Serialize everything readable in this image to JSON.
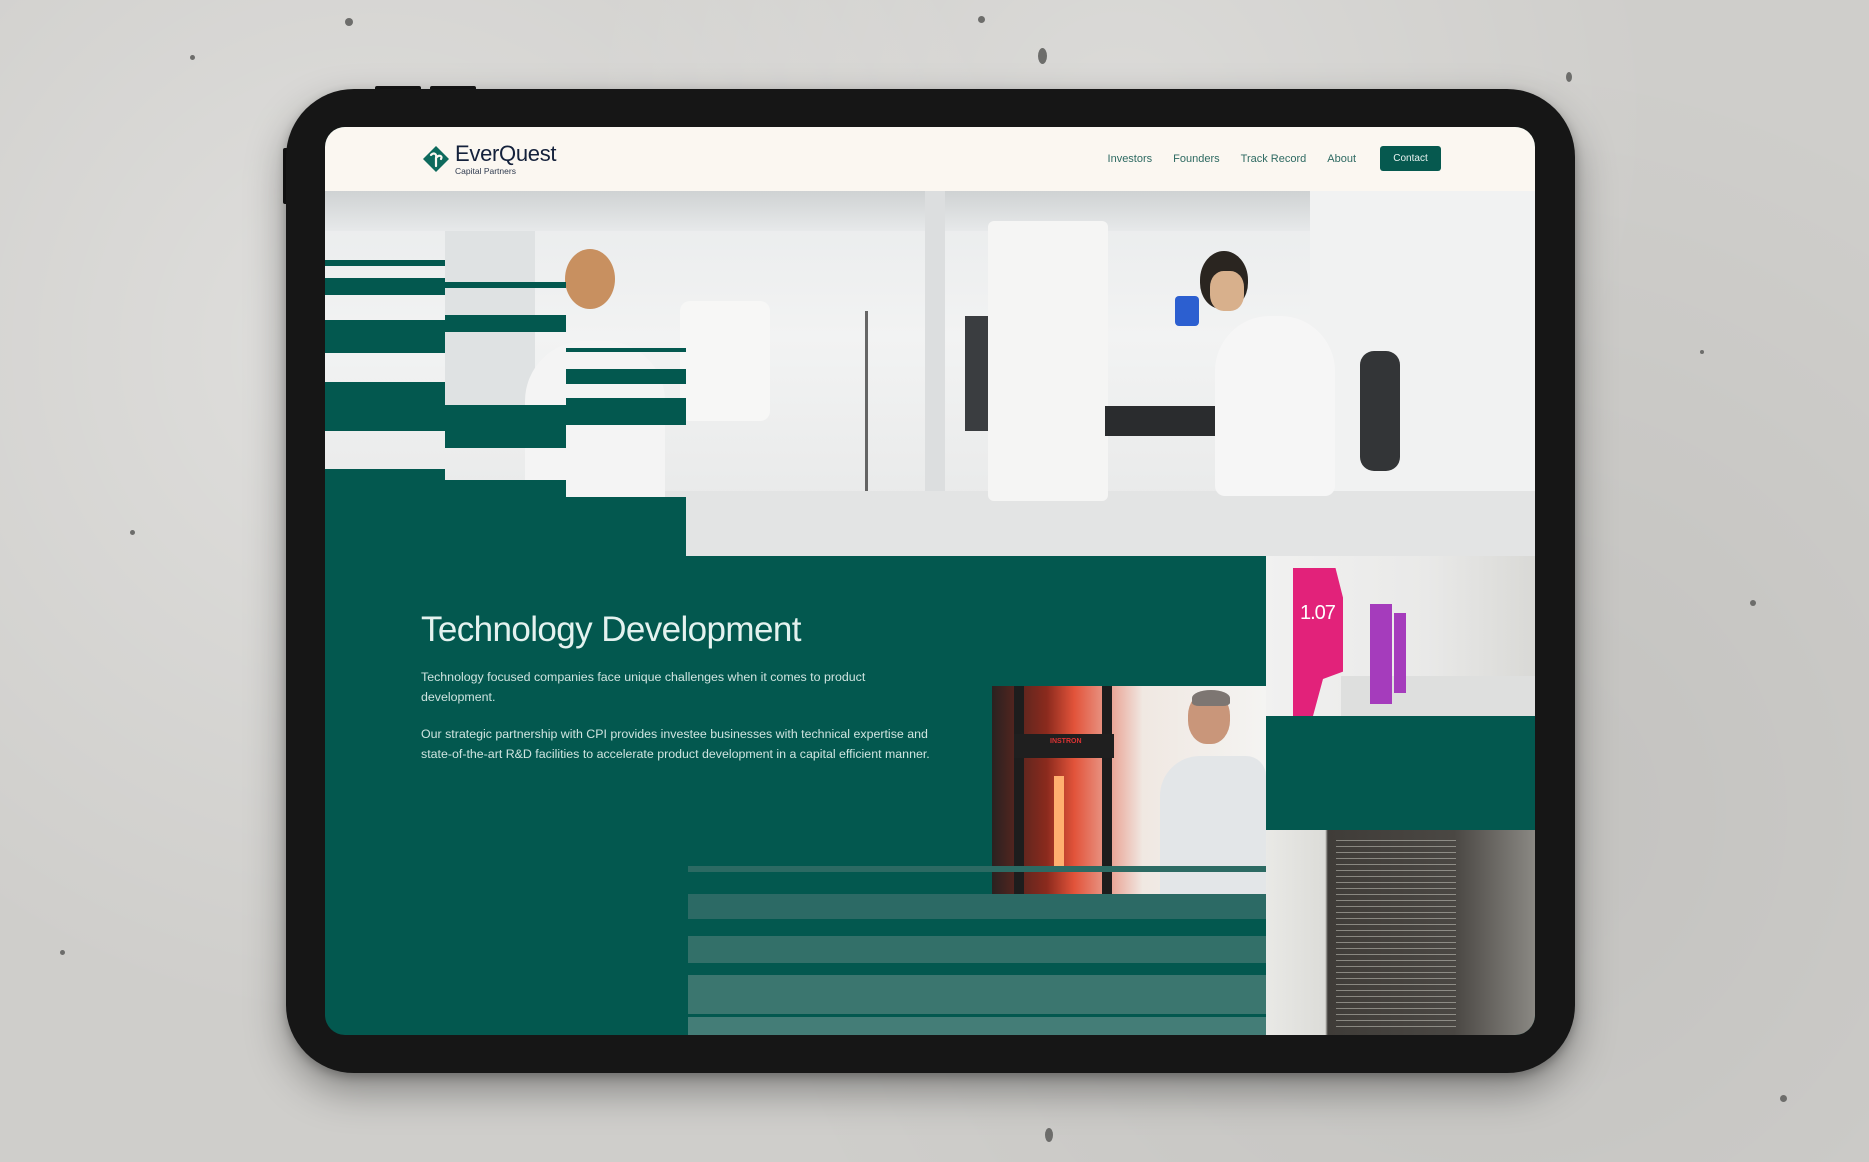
{
  "header": {
    "brand": {
      "name": "EverQuest",
      "tagline": "Capital Partners",
      "logo_icon": "leaf-diamond-icon"
    },
    "nav": [
      {
        "label": "Investors"
      },
      {
        "label": "Founders"
      },
      {
        "label": "Track Record"
      },
      {
        "label": "About"
      }
    ],
    "cta": {
      "label": "Contact"
    }
  },
  "section": {
    "heading": "Technology Development",
    "paragraphs": [
      "Technology focused companies face unique challenges when it comes to product development.",
      "Our strategic partnership with CPI provides investee businesses with technical expertise and state-of-the-art R&D facilities to accelerate product development in a capital efficient manner."
    ]
  },
  "images": {
    "hero": "Two scientists using microscopes in a laboratory",
    "corridor": "Corridor with pink room sign",
    "corridor_sign": "1.07",
    "instron": "Scientist operating an Instron testing machine",
    "instron_brand": "INSTRON",
    "code": "Computer screen displaying code"
  },
  "colors": {
    "brand_teal": "#03584f",
    "header_bg": "#fbf7f1",
    "nav_text": "#2e6a62",
    "brand_navy": "#14213b"
  }
}
